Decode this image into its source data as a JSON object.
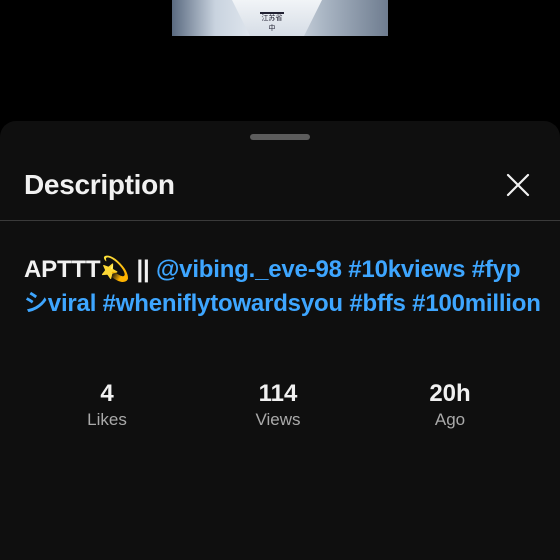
{
  "video_thumbnail": {
    "badge_text": "江苏省中"
  },
  "sheet": {
    "title": "Description",
    "close_icon": "close-icon"
  },
  "description": {
    "title_text": "APTTT",
    "emoji": "💫",
    "separator": " || ",
    "mention": "@vibing._eve-98",
    "hashtags": [
      "#10kviews",
      "#fypシviral",
      "#wheniflytowardsyou",
      "#bffs",
      "#100million"
    ]
  },
  "stats": [
    {
      "value": "4",
      "label": "Likes"
    },
    {
      "value": "114",
      "label": "Views"
    },
    {
      "value": "20h",
      "label": "Ago"
    }
  ],
  "colors": {
    "sheet_background": "#0f0f0f",
    "link": "#3ea6ff",
    "secondary_text": "#aaaaaa"
  }
}
